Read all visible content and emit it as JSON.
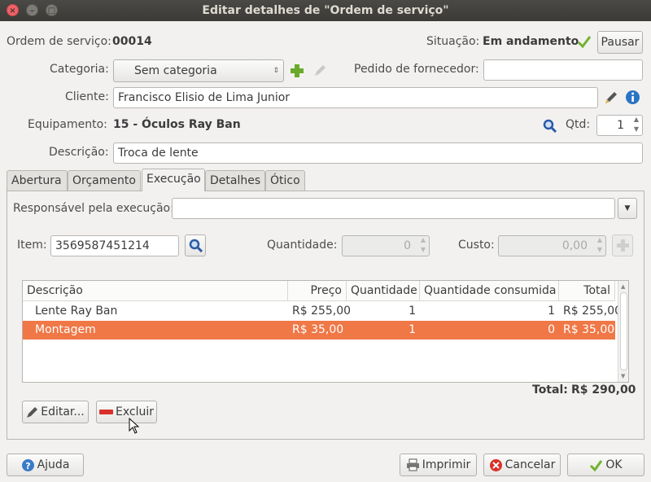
{
  "window": {
    "title": "Editar detalhes de \"Ordem de serviço\""
  },
  "header": {
    "order_label": "Ordem de serviço:",
    "order_number": "00014",
    "status_label": "Situação:",
    "status_value": "Em andamento",
    "pause_button": "Pausar"
  },
  "form": {
    "category_label": "Categoria:",
    "category_value": "Sem categoria",
    "supplier_order_label": "Pedido de fornecedor:",
    "supplier_order_value": "",
    "client_label": "Cliente:",
    "client_value": "Francisco Elisio de Lima Junior",
    "equipment_label": "Equipamento:",
    "equipment_value": "15 - Óculos Ray Ban",
    "qty_label": "Qtd:",
    "qty_value": "1",
    "description_label": "Descrição:",
    "description_value": "Troca de lente"
  },
  "tabs": [
    {
      "label": "Abertura"
    },
    {
      "label": "Orçamento"
    },
    {
      "label": "Execução"
    },
    {
      "label": "Detalhes"
    },
    {
      "label": "Ótico"
    }
  ],
  "execution": {
    "responsible_label": "Responsável pela execução:",
    "responsible_value": "",
    "item_label": "Item:",
    "item_value": "3569587451214",
    "quantity_label": "Quantidade:",
    "quantity_value": "0",
    "cost_label": "Custo:",
    "cost_value": "0,00",
    "table": {
      "columns": [
        "Descrição",
        "Preço",
        "Quantidade",
        "Quantidade consumida",
        "Total"
      ],
      "rows": [
        [
          "Lente Ray Ban",
          "R$ 255,00",
          "1",
          "1",
          "R$ 255,00"
        ],
        [
          "Montagem",
          "R$ 35,00",
          "1",
          "0",
          "R$ 35,00"
        ]
      ]
    },
    "total_label": "Total:",
    "total_value": "R$ 290,00",
    "edit_button": "Editar...",
    "delete_button": "Excluir"
  },
  "footer": {
    "help_button": "Ajuda",
    "print_button": "Imprimir",
    "cancel_button": "Cancelar",
    "ok_button": "OK"
  },
  "colors": {
    "selection": "#f07746",
    "titlebar": "#3b3a37",
    "ok_check": "#73b22f",
    "info": "#2a74c4"
  }
}
